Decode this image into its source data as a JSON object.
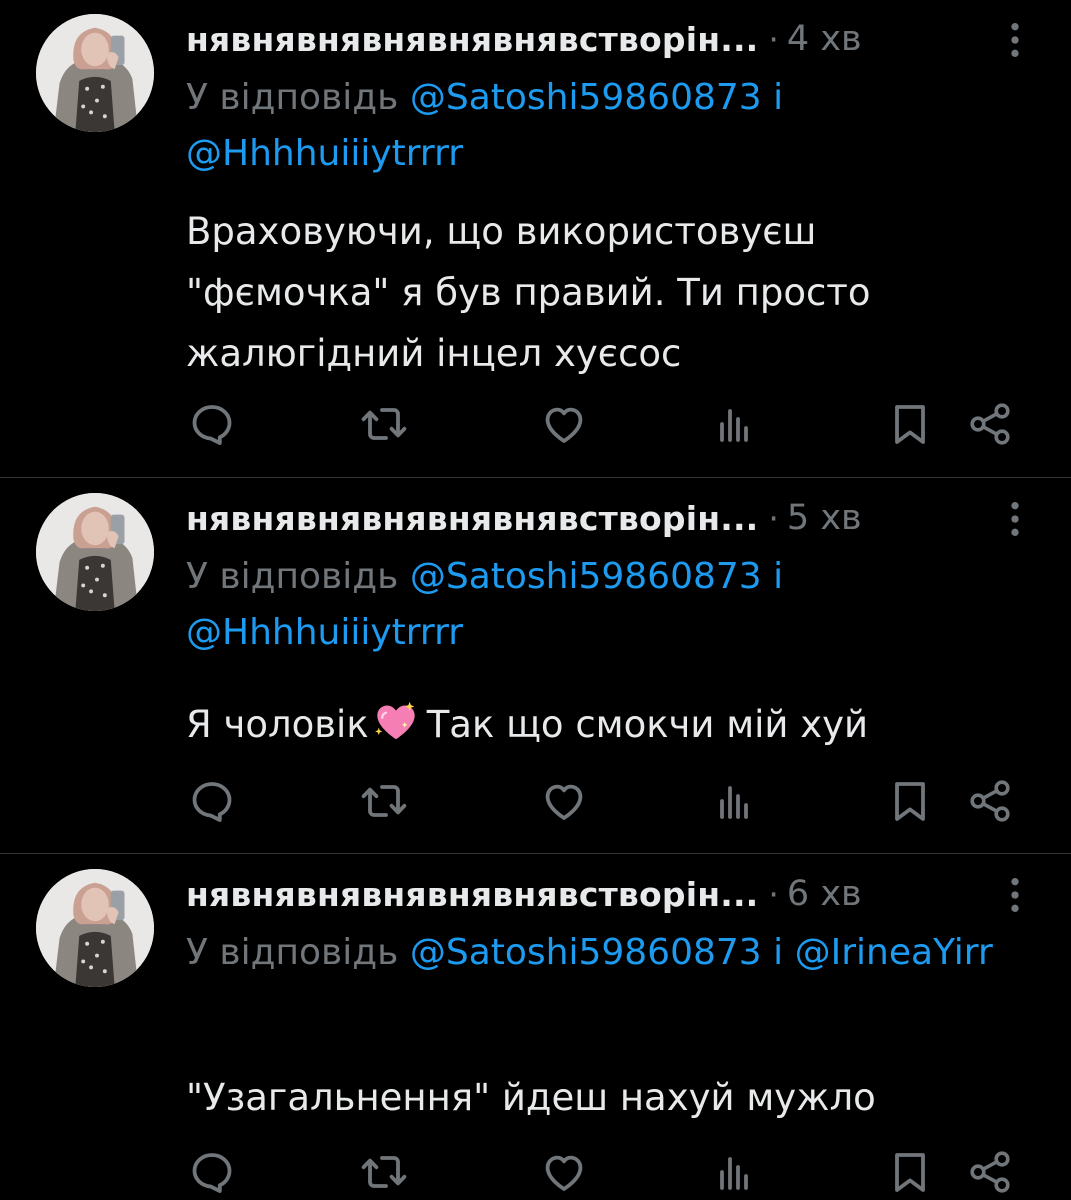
{
  "colors": {
    "background": "#000000",
    "text": "#e7e9ea",
    "muted": "#71767b",
    "link": "#1d9bf0",
    "divider": "#2f3336"
  },
  "tweets": [
    {
      "author": "нявнявнявнявнявнявстворін...",
      "separator": "·",
      "time": "4 хв",
      "reply_prefix": "У відповідь",
      "mention1": "@Satoshi59860873",
      "conjunction": "і",
      "mention2": "@Hhhhuiiiytrrrr",
      "text": "Враховуючи, що використовуєш \"фємочка\" я був правий. Ти просто жалюгідний інцел хуєсос"
    },
    {
      "author": "нявнявнявнявнявнявстворін...",
      "separator": "·",
      "time": "5 хв",
      "reply_prefix": "У відповідь",
      "mention1": "@Satoshi59860873",
      "conjunction": "і",
      "mention2": "@Hhhhuiiiytrrrr",
      "text_before_emoji": "Я чоловік",
      "emoji": "sparkling-heart-emoji",
      "text_after_emoji": "Так що смокчи мій хуй"
    },
    {
      "author": "нявнявнявнявнявнявстворін...",
      "separator": "·",
      "time": "6 хв",
      "reply_prefix": "У відповідь",
      "mention1": "@Satoshi59860873",
      "conjunction": "і",
      "mention2": "@IrineaYirr",
      "text": "\"Узагальнення\" йдеш нахуй мужло"
    }
  ],
  "action_icons": [
    "reply-icon",
    "retweet-icon",
    "like-icon",
    "views-icon",
    "bookmark-icon",
    "share-icon"
  ]
}
